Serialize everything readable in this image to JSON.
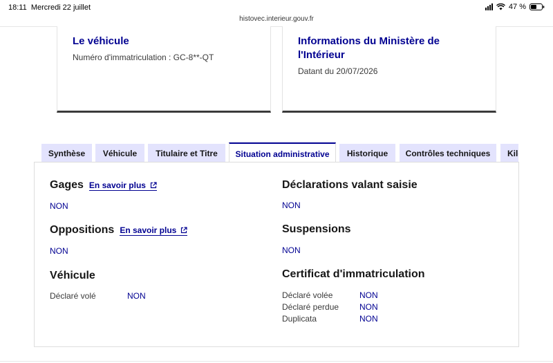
{
  "status_bar": {
    "time": "18:11",
    "date": "Mercredi 22 juillet",
    "battery": "47 %"
  },
  "url": "histovec.interieur.gouv.fr",
  "cards": {
    "vehicle": {
      "title": "Le véhicule",
      "plate_text": "Numéro d'immatriculation : GC-8**-QT"
    },
    "ministry": {
      "title_line1": "Informations du Ministère de",
      "title_line2": "l'Intérieur",
      "date_text": "Datant du 20/07/2026"
    }
  },
  "tabs": [
    {
      "label": "Synthèse"
    },
    {
      "label": "Véhicule"
    },
    {
      "label": "Titulaire et Titre"
    },
    {
      "label": "Situation administrative",
      "active": true
    },
    {
      "label": "Historique"
    },
    {
      "label": "Contrôles techniques"
    },
    {
      "label": "Kilo"
    }
  ],
  "sections": {
    "gages": {
      "title": "Gages",
      "link": "En savoir plus",
      "value": "NON"
    },
    "oppositions": {
      "title": "Oppositions",
      "link": "En savoir plus",
      "value": "NON"
    },
    "vehicule": {
      "title": "Véhicule",
      "stolen_label": "Déclaré volé",
      "stolen_value": "NON"
    },
    "declarations": {
      "title": "Déclarations valant saisie",
      "value": "NON"
    },
    "suspensions": {
      "title": "Suspensions",
      "value": "NON"
    },
    "certificat": {
      "title": "Certificat d'immatriculation",
      "rows": [
        {
          "label": "Déclaré volée",
          "value": "NON"
        },
        {
          "label": "Déclaré perdue",
          "value": "NON"
        },
        {
          "label": "Duplicata",
          "value": "NON"
        }
      ]
    }
  },
  "colors": {
    "accent": "#000091",
    "tab_bg": "#e3e3fd",
    "text": "#161616"
  },
  "icons": {
    "external_link": "external-link-icon"
  }
}
